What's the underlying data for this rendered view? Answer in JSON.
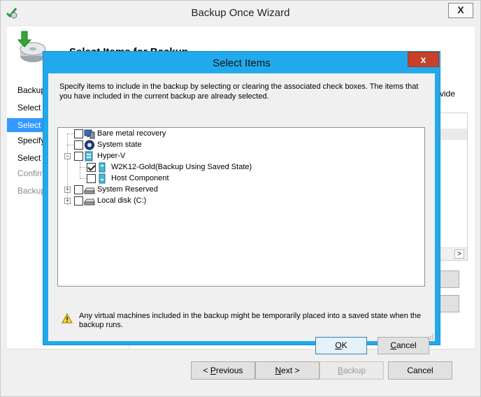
{
  "wizard": {
    "title": "Backup Once Wizard",
    "close_label": "X",
    "header_title": "Select Items for Backup",
    "nav": [
      {
        "label": "Backup Options",
        "state": "normal"
      },
      {
        "label": "Select Backup Configuration",
        "state": "normal"
      },
      {
        "label": "Select Items for Backup",
        "state": "active"
      },
      {
        "label": "Specify Destination Type",
        "state": "normal"
      },
      {
        "label": "Select Backup Destination",
        "state": "normal"
      },
      {
        "label": "Confirmation",
        "state": "disabled"
      },
      {
        "label": "Backup Progress",
        "state": "disabled"
      }
    ],
    "content_text_fragment": "vide",
    "side_button_fragment": "s",
    "buttons": {
      "previous_pre": "< ",
      "previous_key": "P",
      "previous_rest": "revious",
      "next_key": "N",
      "next_rest": "ext >",
      "backup_key": "B",
      "backup_rest": "ackup",
      "cancel": "Cancel"
    }
  },
  "dialog": {
    "title": "Select Items",
    "close_label": "x",
    "description": "Specify items to include in the backup by selecting or clearing the associated check boxes. The items that you have included in the current backup are already selected.",
    "tree": [
      {
        "label": "Bare metal recovery",
        "checked": false,
        "icon": "bare-metal-icon"
      },
      {
        "label": "System state",
        "checked": false,
        "icon": "system-state-icon"
      },
      {
        "label": "Hyper-V",
        "checked": false,
        "icon": "hyper-v-icon",
        "expanded": true
      },
      {
        "label": "W2K12-Gold(Backup Using Saved State)",
        "checked": true,
        "icon": "virtual-machine-icon"
      },
      {
        "label": "Host Component",
        "checked": false,
        "icon": "host-component-icon"
      },
      {
        "label": "System Reserved",
        "checked": false,
        "icon": "drive-icon",
        "expanded": false
      },
      {
        "label": "Local disk (C:)",
        "checked": false,
        "icon": "drive-icon",
        "expanded": false
      }
    ],
    "warning": "Any virtual machines included in the backup might be temporarily placed into a saved state when the backup runs.",
    "ok_key": "O",
    "ok_rest": "K",
    "cancel_key": "C",
    "cancel_rest": "ancel"
  },
  "colors": {
    "dialog_border": "#22a9ec",
    "close_button": "#c7412a",
    "selection": "#3399ff"
  }
}
